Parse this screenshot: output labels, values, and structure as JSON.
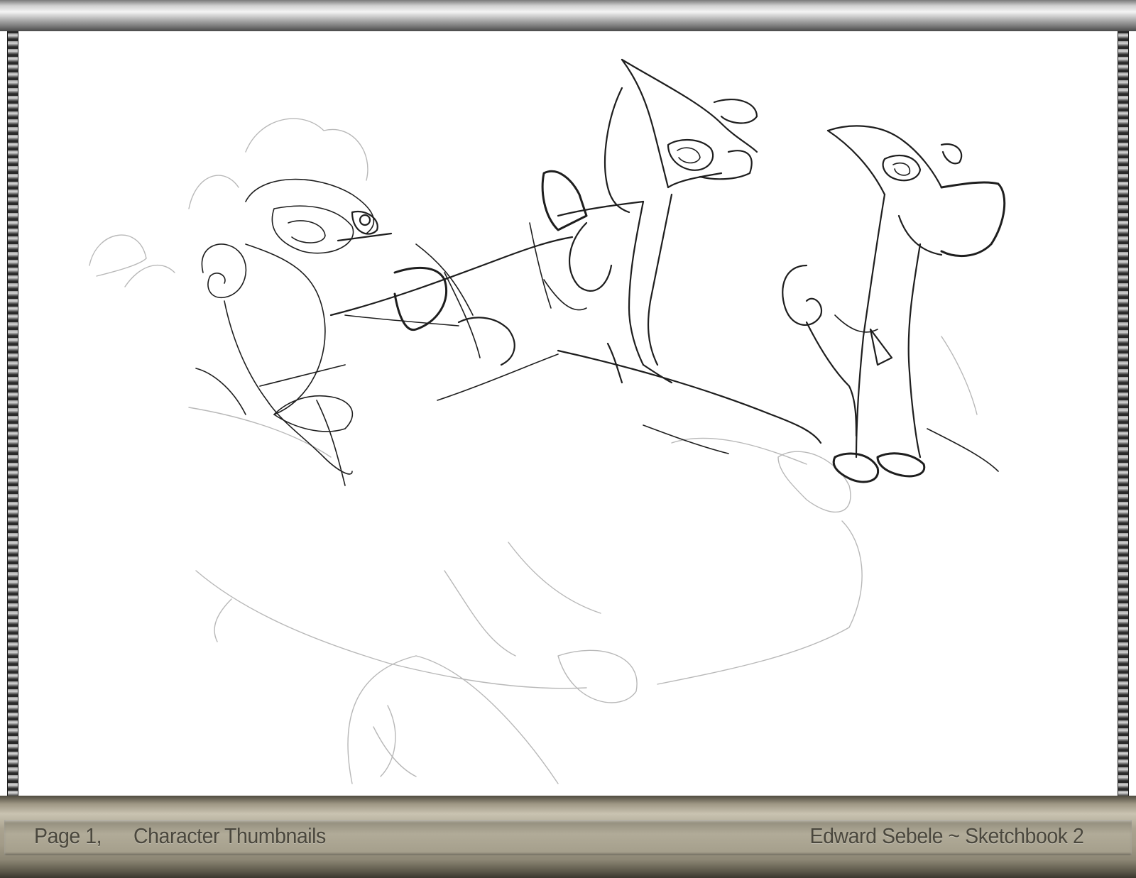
{
  "footer": {
    "page_label": "Page 1,",
    "page_title": "Character Thumbnails",
    "author_credit": "Edward Sebele ~ Sketchbook 2"
  },
  "colors": {
    "frame_top": "#bdbdbd",
    "frame_bottom": "#a29b88",
    "caption_text": "#4a473d",
    "paper": "#ffffff",
    "pencil": "#1e1e1e"
  }
}
